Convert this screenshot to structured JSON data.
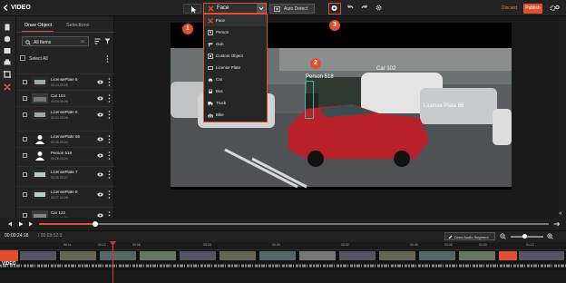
{
  "app": {
    "title": "VIDEO"
  },
  "toolbar": {
    "object_dropdown": "Face",
    "auto_detect": "Auto Detect",
    "discard": "Discard",
    "publish": "Publish"
  },
  "panel": {
    "tabs": [
      "Draw Object",
      "Selections"
    ],
    "filter_label": "All Items",
    "filter_count": "181",
    "select_all": "Select All",
    "items": [
      {
        "name": "LicensePlate 5",
        "time": "00:24-00:25"
      },
      {
        "name": "Car 104",
        "time": "00:24-00:26"
      },
      {
        "name": "LicensePlate 6",
        "time": "00:24-00:26"
      },
      {
        "name": "LicensePlate 66",
        "time": "00:26-00:24"
      },
      {
        "name": "Person 518",
        "time": "00:26-00:24"
      },
      {
        "name": "LicensePlate 7",
        "time": "00:26-00:27"
      },
      {
        "name": "LicensePlate 8",
        "time": "00:27-00:28"
      },
      {
        "name": "Car 122",
        "time": "00:44-00:37"
      }
    ]
  },
  "menu": {
    "items": [
      {
        "label": "Face",
        "icon": "face-icon"
      },
      {
        "label": "Person",
        "icon": "person-icon"
      },
      {
        "label": "Gun",
        "icon": "gun-icon"
      },
      {
        "label": "Custom Object",
        "icon": "custom-object-icon"
      },
      {
        "label": "License Plate",
        "icon": "license-plate-icon"
      },
      {
        "label": "Car",
        "icon": "car-icon"
      },
      {
        "label": "Bus",
        "icon": "bus-icon"
      },
      {
        "label": "Truck",
        "icon": "truck-icon"
      },
      {
        "label": "Bike",
        "icon": "bike-icon"
      }
    ]
  },
  "video_labels": {
    "person": "Person 518",
    "car": "Car 102",
    "plate": "License Plate 66"
  },
  "callouts": [
    "1",
    "2",
    "3"
  ],
  "playback": {
    "current_time": "00:00:24:18",
    "duration": "/ 00:03:52:3",
    "draw_audio_segment": "Draw Audio Segment",
    "progress": 0.11,
    "zoom": 0.42
  },
  "timeline": {
    "ticks": [
      "00:1s",
      "00:12",
      "00:08",
      "00:16",
      "00:24",
      "00:32",
      "00:40",
      "00:48",
      "01:04",
      "01:12"
    ],
    "track_label": "VIDEO"
  },
  "colors": {
    "accent": "#e05030",
    "panel": "#232323",
    "stage": "#1a1a1a"
  }
}
